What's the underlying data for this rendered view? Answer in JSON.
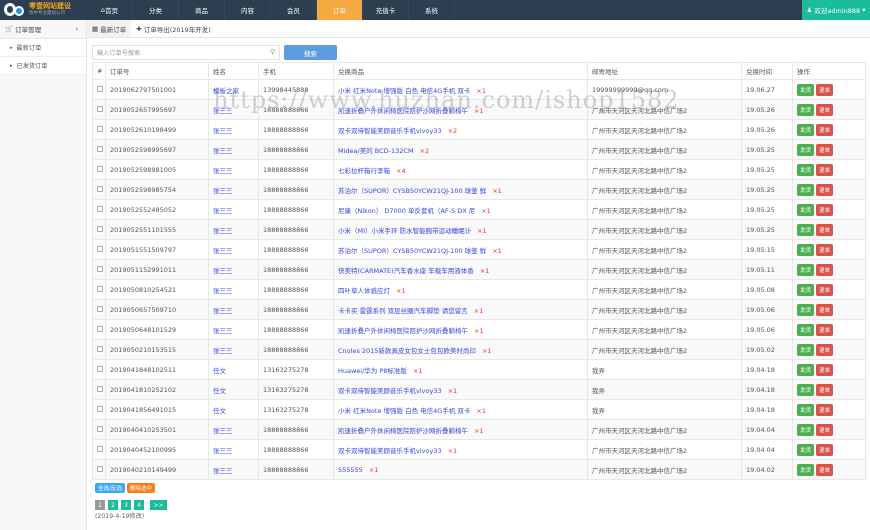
{
  "brand": {
    "title": "零壹网站建设",
    "subtitle": "扬中专业建站公司"
  },
  "nav": [
    {
      "label": "首页",
      "icon": "home-icon"
    },
    {
      "label": "分类"
    },
    {
      "label": "商品"
    },
    {
      "label": "内容"
    },
    {
      "label": "会员"
    },
    {
      "label": "订单",
      "active": true
    },
    {
      "label": "充值卡"
    },
    {
      "label": "系统"
    }
  ],
  "user": {
    "label": "欢迎admin888"
  },
  "sidebar": {
    "header": "订单管理",
    "items": [
      {
        "label": "最新订单"
      },
      {
        "label": "已发货订单"
      }
    ]
  },
  "tabs": [
    {
      "label": "最新订单",
      "active": true
    },
    {
      "label": "订单导出(2019年开发)"
    }
  ],
  "search": {
    "placeholder": "输入订单号搜索",
    "button": "搜索"
  },
  "table": {
    "headers": [
      "#",
      "订单号",
      "姓名",
      "手机",
      "兑换商品",
      "邮寄地址",
      "兑换时间",
      "操作"
    ],
    "actions": {
      "ship": "发货",
      "refund": "退单"
    },
    "rows": [
      {
        "order": "2019062797501001",
        "name": "模板之家",
        "phone": "13998445888",
        "product": "小米 红米Note 增强版 白色 电信4G手机 双卡",
        "qty": "×1",
        "address": "19999999999@qq.com",
        "time": "19.06.27"
      },
      {
        "order": "2019052657995697",
        "name": "张三三",
        "phone": "18888888866",
        "product": "凯速折叠户外休闲椅医院陪护沙网折叠躺椅午",
        "qty": "×1",
        "address": "广州市天河区天河北路中信广场2",
        "time": "19.05.26"
      },
      {
        "order": "2019052610198499",
        "name": "张三三",
        "phone": "18888888866",
        "product": "双卡双待智能美颜音乐手机vivoy33",
        "qty": "×2",
        "address": "广州市天河区天河北路中信广场2",
        "time": "19.05.26"
      },
      {
        "order": "2019052598995697",
        "name": "张三三",
        "phone": "18888888866",
        "product": "Midea/美的 BCD-132CM",
        "qty": "×2",
        "address": "广州市天河区天河北路中信广场2",
        "time": "19.05.25"
      },
      {
        "order": "2019052598981005",
        "name": "张三三",
        "phone": "18888888866",
        "product": "七彩拉杆箱行李箱",
        "qty": "×4",
        "address": "广州市天河区天河北路中信广场2",
        "time": "19.05.25"
      },
      {
        "order": "2019052598985754",
        "name": "张三三",
        "phone": "18888888866",
        "product": "苏泊尔（SUPOR）CYSB50YCW21QJ-100 球釜 鲜",
        "qty": "×1",
        "address": "广州市天河区天河北路中信广场2",
        "time": "19.05.25"
      },
      {
        "order": "2019052552485052",
        "name": "张三三",
        "phone": "18888888866",
        "product": "尼康（Nikon） D7000 单反套机（AF-S DX 尼",
        "qty": "×1",
        "address": "广州市天河区天河北路中信广场2",
        "time": "19.05.25"
      },
      {
        "order": "2019052551101555",
        "name": "张三三",
        "phone": "18888888866",
        "product": "小米（MI）小米手环 防水智能腕带运动睡眠计",
        "qty": "×1",
        "address": "广州市天河区天河北路中信广场2",
        "time": "19.05.25"
      },
      {
        "order": "2019051551509797",
        "name": "张三三",
        "phone": "18888888866",
        "product": "苏泊尔（SUPOR）CYSB50YCW21QJ-100 球釜 鲜",
        "qty": "×1",
        "address": "广州市天河区天河北路中信广场2",
        "time": "19.05.15"
      },
      {
        "order": "2019051152991011",
        "name": "张三三",
        "phone": "18888888866",
        "product": "快美特(CARMATE)汽车香水座 车载车用液体香",
        "qty": "×1",
        "address": "广州市天河区天河北路中信广场2",
        "time": "19.05.11"
      },
      {
        "order": "2019050810254521",
        "name": "张三三",
        "phone": "18888888866",
        "product": "四叶草人体感应灯",
        "qty": "×1",
        "address": "广州市天河区天河北路中信广场2",
        "time": "19.05.08"
      },
      {
        "order": "2019050657509710",
        "name": "张三三",
        "phone": "18888888866",
        "product": "卡卡买 雷霆系列 双层丝圈汽车脚垫 请您留言",
        "qty": "×1",
        "address": "广州市天河区天河北路中信广场2",
        "time": "19.05.06"
      },
      {
        "order": "2019050648101529",
        "name": "张三三",
        "phone": "18888888866",
        "product": "凯速折叠户外休闲椅医院陪护沙网折叠躺椅午",
        "qty": "×1",
        "address": "广州市天河区天河北路中信广场2",
        "time": "19.05.06"
      },
      {
        "order": "2019050210153515",
        "name": "张三三",
        "phone": "18888888866",
        "product": "Cnoles 2015新款真皮女包女士包包欧美时尚印",
        "qty": "×1",
        "address": "广州市天河区天河北路中信广场2",
        "time": "19.05.02"
      },
      {
        "order": "2019041848102511",
        "name": "任文",
        "phone": "13163275278",
        "product": "Huawei/华为 P8标准版",
        "qty": "×1",
        "address": "我弄",
        "time": "19.04.18"
      },
      {
        "order": "2019041810252102",
        "name": "任文",
        "phone": "13163275278",
        "product": "双卡双待智能美颜音乐手机vivoy33",
        "qty": "×1",
        "address": "我弄",
        "time": "19.04.18"
      },
      {
        "order": "2019041856491015",
        "name": "任文",
        "phone": "13163275278",
        "product": "小米 红米Note 增强版 白色 电信4G手机 双卡",
        "qty": "×1",
        "address": "我弄",
        "time": "19.04.18"
      },
      {
        "order": "2019040410253501",
        "name": "张三三",
        "phone": "18888888866",
        "product": "凯速折叠户外休闲椅医院陪护沙网折叠躺椅午",
        "qty": "×1",
        "address": "广州市天河区天河北路中信广场2",
        "time": "19.04.04"
      },
      {
        "order": "2019040452100995",
        "name": "张三三",
        "phone": "18888888866",
        "product": "双卡双待智能美颜音乐手机vivoy33",
        "qty": "×1",
        "address": "广州市天河区天河北路中信广场2",
        "time": "19.04.04"
      },
      {
        "order": "2019040210149499",
        "name": "张三三",
        "phone": "18888888866",
        "product": "555555",
        "qty": "×1",
        "address": "广州市天河区天河北路中信广场2",
        "time": "19.04.02"
      }
    ]
  },
  "bulk": {
    "select_all": "全选/反选",
    "delete_selected": "删除选中"
  },
  "pagination": {
    "pages": [
      "1",
      "2",
      "3",
      "4"
    ],
    "next": ">>",
    "current": "1"
  },
  "note": "(2019-4-19修改)",
  "watermark": "https://www.huzhan.com/ishop1582",
  "colors": {
    "nav_bg": "#2c3e50",
    "active_nav": "#f5a940",
    "user": "#1abc9c",
    "ship": "#4cae4c",
    "refund": "#d9534f"
  }
}
